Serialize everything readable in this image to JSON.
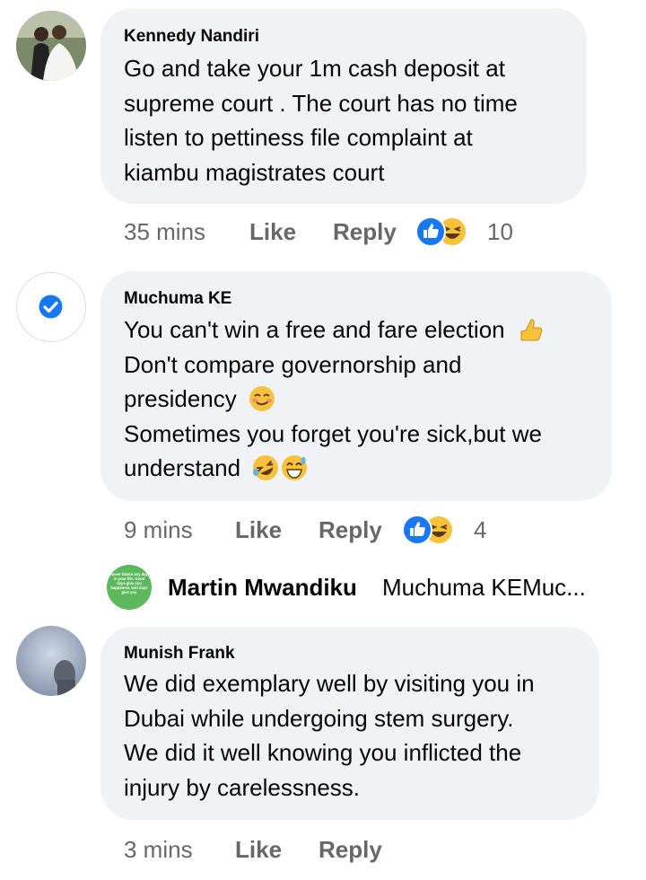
{
  "comments": [
    {
      "author": "Kennedy Nandiri",
      "lines": [
        "Go and take your 1m cash deposit at",
        "supreme court . The court has no time",
        "listen to pettiness file complaint at",
        "kiambu magistrates court"
      ],
      "time": "35 mins",
      "like": "Like",
      "reply": "Reply",
      "reaction_count": "10"
    },
    {
      "author": "Muchuma KE",
      "lines": [
        "You can't win a free and fare election",
        "Don't compare governorship and",
        "presidency",
        "Sometimes you forget you're sick,but we",
        "understand"
      ],
      "time": "9 mins",
      "like": "Like",
      "reply": "Reply",
      "reaction_count": "4"
    },
    {
      "author": "Munish Frank",
      "lines": [
        "We did exemplary well by visiting you in",
        "Dubai  while undergoing stem surgery.",
        "We did it well knowing you inflicted the",
        "injury by carelessness."
      ],
      "time": "3 mins",
      "like": "Like",
      "reply": "Reply"
    }
  ],
  "reply_preview": {
    "author": "Martin Mwandiku",
    "snippet": "Muchuma KEMuc...",
    "avatar_text": "Never blame any day in your life. Good days give you happiness, bad days give you"
  },
  "icons": [
    "like-icon",
    "haha-icon",
    "check-icon",
    "thumbs-up-emoji-icon",
    "smirk-emoji-icon",
    "rofl-emoji-icon",
    "grinning-sweat-emoji-icon"
  ],
  "colors": {
    "bubble": "#f0f2f5",
    "meta": "#65676b",
    "like_blue": "#1877f2",
    "badge_green": "#4caf50"
  }
}
